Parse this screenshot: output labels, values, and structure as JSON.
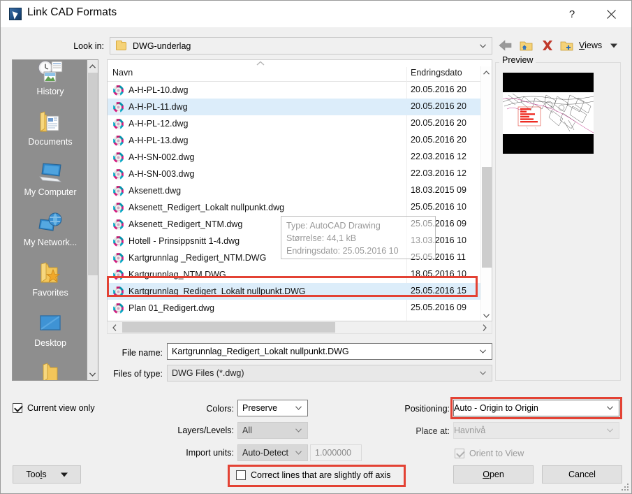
{
  "window": {
    "title": "Link CAD Formats",
    "app_icon": "autocad-app-icon",
    "help_label": "?",
    "close_label": "close-icon"
  },
  "lookin": {
    "label": "Look in:",
    "value": "DWG-underlag",
    "folder_icon": "folder-icon",
    "arrow_icon": "chevron-down-icon"
  },
  "toolbar": {
    "back": "back-arrow-icon",
    "up_one_level": "up-folder-icon",
    "delete": "delete-x-icon",
    "new_folder": "new-folder-icon",
    "views_label": "Views",
    "views_arrow": "chevron-down-icon"
  },
  "places": [
    {
      "label": "History",
      "icon": "history-clock-icon"
    },
    {
      "label": "Documents",
      "icon": "documents-folder-icon"
    },
    {
      "label": "My Computer",
      "icon": "my-computer-icon"
    },
    {
      "label": "My Network...",
      "icon": "my-network-icon"
    },
    {
      "label": "Favorites",
      "icon": "favorites-star-folder-icon"
    },
    {
      "label": "Desktop",
      "icon": "desktop-icon"
    },
    {
      "label": "",
      "icon": "folder-icon"
    }
  ],
  "filelist": {
    "sort_indicator": "sort-ascending-chevron-icon",
    "columns": [
      "Navn",
      "Endringsdato"
    ],
    "rows": [
      {
        "name": "A-H-PL-10.dwg",
        "date": "20.05.2016 20",
        "selected": false
      },
      {
        "name": "A-H-PL-11.dwg",
        "date": "20.05.2016 20",
        "selected": true
      },
      {
        "name": "A-H-PL-12.dwg",
        "date": "20.05.2016 20",
        "selected": false
      },
      {
        "name": "A-H-PL-13.dwg",
        "date": "20.05.2016 20",
        "selected": false
      },
      {
        "name": "A-H-SN-002.dwg",
        "date": "22.03.2016 12",
        "selected": false
      },
      {
        "name": "A-H-SN-003.dwg",
        "date": "22.03.2016 12",
        "selected": false
      },
      {
        "name": "Aksenett.dwg",
        "date": "18.03.2015 09",
        "selected": false
      },
      {
        "name": "Aksenett_Redigert_Lokalt nullpunkt.dwg",
        "date": "25.05.2016 10",
        "selected": false
      },
      {
        "name": "Aksenett_Redigert_NTM.dwg",
        "date": "25.05.2016 09",
        "selected": false
      },
      {
        "name": "Hotell - Prinsippsnitt 1-4.dwg",
        "date": "13.03.2016 10",
        "selected": false
      },
      {
        "name": "Kartgrunnlag _Redigert_NTM.DWG",
        "date": "25.05.2016 11",
        "selected": false
      },
      {
        "name": "Kartgrunnlag_NTM.DWG",
        "date": "18.05.2016 10",
        "selected": false
      },
      {
        "name": "Kartgrunnlag_Redigert_Lokalt nullpunkt.DWG",
        "date": "25.05.2016 15",
        "selected": true
      },
      {
        "name": "Plan 01_Redigert.dwg",
        "date": "25.05.2016 09",
        "selected": false
      }
    ],
    "file_icon": "dwg-file-icon"
  },
  "tooltip": {
    "line1": "Type: AutoCAD Drawing",
    "line2": "Størrelse: 44,1 kB",
    "line3": "Endringsdato: 25.05.2016 10"
  },
  "preview": {
    "legend": "Preview",
    "content": "cad-map-drawing-thumbnail"
  },
  "fields": {
    "file_name_label": "File name:",
    "file_name_value": "Kartgrunnlag_Redigert_Lokalt nullpunkt.DWG",
    "files_of_type_label": "Files of type:",
    "files_of_type_value": "DWG Files  (*.dwg)"
  },
  "options": {
    "current_view_only_label": "Current view only",
    "current_view_only_checked": true,
    "tools_label": "Tools",
    "colors_label": "Colors:",
    "colors_value": "Preserve",
    "layers_label": "Layers/Levels:",
    "layers_value": "All",
    "import_units_label": "Import units:",
    "import_units_value": "Auto-Detect",
    "import_units_scale": "1.000000",
    "positioning_label": "Positioning:",
    "positioning_value": "Auto - Origin to Origin",
    "place_at_label": "Place at:",
    "place_at_value": "Havnivå",
    "orient_to_view_label": "Orient to View",
    "orient_to_view_checked": true,
    "correct_lines_label": "Correct lines that are slightly off axis",
    "correct_lines_checked": false
  },
  "buttons": {
    "open_label": "Open",
    "cancel_label": "Cancel"
  },
  "annotations": {
    "accent_red": "#e34234",
    "selection_blue": "#dcedfa",
    "highlight_count": 3
  }
}
